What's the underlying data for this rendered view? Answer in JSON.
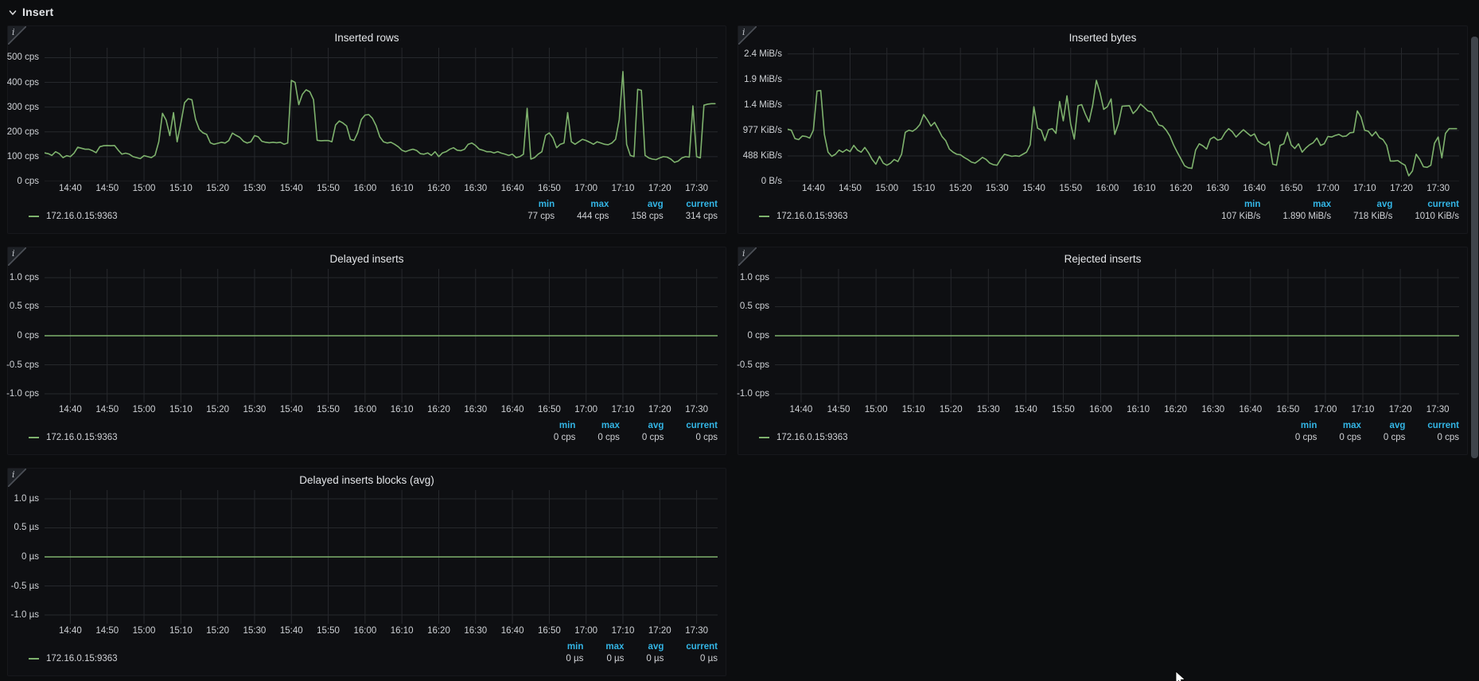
{
  "section": {
    "label": "Insert",
    "state": "expanded"
  },
  "legend": {
    "headers": [
      "min",
      "max",
      "avg",
      "current"
    ]
  },
  "time": {
    "domain": [
      873,
      1055.7
    ],
    "ticks": [
      {
        "v": 880,
        "l": "14:40"
      },
      {
        "v": 890,
        "l": "14:50"
      },
      {
        "v": 900,
        "l": "15:00"
      },
      {
        "v": 910,
        "l": "15:10"
      },
      {
        "v": 920,
        "l": "15:20"
      },
      {
        "v": 930,
        "l": "15:30"
      },
      {
        "v": 940,
        "l": "15:40"
      },
      {
        "v": 950,
        "l": "15:50"
      },
      {
        "v": 960,
        "l": "16:00"
      },
      {
        "v": 970,
        "l": "16:10"
      },
      {
        "v": 980,
        "l": "16:20"
      },
      {
        "v": 990,
        "l": "16:30"
      },
      {
        "v": 1000,
        "l": "16:40"
      },
      {
        "v": 1010,
        "l": "16:50"
      },
      {
        "v": 1020,
        "l": "17:00"
      },
      {
        "v": 1030,
        "l": "17:10"
      },
      {
        "v": 1040,
        "l": "17:20"
      },
      {
        "v": 1050,
        "l": "17:30"
      }
    ]
  },
  "panels": [
    {
      "id": "inserted-rows",
      "title": "Inserted rows",
      "type": "line",
      "col": 1,
      "row": 1,
      "yaxis_width": 46,
      "ydomain": [
        0,
        540
      ],
      "yticks": [
        {
          "v": 500,
          "l": "500 cps"
        },
        {
          "v": 400,
          "l": "400 cps"
        },
        {
          "v": 300,
          "l": "300 cps"
        },
        {
          "v": 200,
          "l": "200 cps"
        },
        {
          "v": 100,
          "l": "100 cps"
        },
        {
          "v": 0,
          "l": "0 cps"
        }
      ],
      "series": {
        "name": "172.16.0.15:9363",
        "color": "#7eb26d",
        "t0": 873,
        "dt": 1,
        "values": [
          115,
          112,
          105,
          120,
          112,
          96,
          104,
          100,
          114,
          138,
          134,
          130,
          130,
          124,
          116,
          140,
          144,
          145,
          144,
          145,
          126,
          110,
          114,
          110,
          100,
          96,
          92,
          104,
          100,
          96,
          106,
          160,
          275,
          248,
          185,
          278,
          160,
          235,
          318,
          334,
          330,
          250,
          210,
          196,
          190,
          156,
          150,
          154,
          158,
          155,
          165,
          195,
          186,
          178,
          162,
          155,
          160,
          185,
          180,
          162,
          158,
          156,
          158,
          156,
          158,
          150,
          155,
          408,
          400,
          310,
          352,
          370,
          362,
          330,
          166,
          164,
          165,
          165,
          160,
          228,
          244,
          236,
          224,
          170,
          165,
          196,
          250,
          268,
          270,
          255,
          225,
          180,
          160,
          155,
          158,
          150,
          140,
          126,
          120,
          126,
          130,
          125,
          112,
          110,
          115,
          105,
          120,
          100,
          115,
          120,
          130,
          136,
          126,
          124,
          130,
          150,
          155,
          145,
          130,
          126,
          120,
          120,
          115,
          120,
          114,
          110,
          105,
          110,
          96,
          100,
          110,
          295,
          90,
          96,
          110,
          120,
          186,
          196,
          176,
          136,
          150,
          155,
          278,
          160,
          150,
          160,
          170,
          165,
          158,
          150,
          160,
          155,
          150,
          148,
          155,
          170,
          250,
          444,
          150,
          105,
          100,
          372,
          368,
          105,
          95,
          90,
          88,
          95,
          100,
          98,
          90,
          77,
          82,
          95,
          100,
          98,
          305,
          100,
          95,
          308,
          312,
          314,
          314
        ]
      },
      "stats": [
        "77 cps",
        "444 cps",
        "158 cps",
        "314 cps"
      ]
    },
    {
      "id": "inserted-bytes",
      "title": "Inserted bytes",
      "type": "line",
      "col": 2,
      "row": 1,
      "yaxis_width": 62,
      "ydomain": [
        0,
        2560
      ],
      "yticks": [
        {
          "v": 2441,
          "l": "2.4 MiB/s"
        },
        {
          "v": 1953,
          "l": "1.9 MiB/s"
        },
        {
          "v": 1465,
          "l": "1.4 MiB/s"
        },
        {
          "v": 977,
          "l": "977 KiB/s"
        },
        {
          "v": 488,
          "l": "488 KiB/s"
        },
        {
          "v": 0,
          "l": "0 B/s"
        }
      ],
      "series": {
        "name": "172.16.0.15:9363",
        "color": "#7eb26d",
        "t0": 873,
        "dt": 1,
        "values": [
          1000,
          980,
          820,
          800,
          870,
          860,
          830,
          980,
          1730,
          1740,
          900,
          560,
          480,
          520,
          600,
          560,
          610,
          570,
          690,
          600,
          560,
          650,
          550,
          420,
          330,
          480,
          350,
          310,
          350,
          420,
          380,
          520,
          940,
          980,
          960,
          1010,
          1090,
          1280,
          1180,
          1060,
          1130,
          1000,
          860,
          780,
          620,
          560,
          520,
          510,
          460,
          420,
          370,
          350,
          400,
          460,
          420,
          350,
          320,
          310,
          430,
          520,
          500,
          480,
          490,
          480,
          520,
          560,
          700,
          1430,
          1020,
          980,
          780,
          990,
          1010,
          920,
          1530,
          1160,
          1640,
          1100,
          810,
          1450,
          1470,
          1290,
          1140,
          1460,
          1935,
          1700,
          1380,
          1430,
          1580,
          900,
          1100,
          1440,
          1445,
          1450,
          1300,
          1370,
          1480,
          1420,
          1350,
          1330,
          1200,
          1080,
          1060,
          980,
          870,
          700,
          560,
          430,
          300,
          260,
          250,
          600,
          720,
          680,
          620,
          810,
          850,
          790,
          810,
          930,
          1010,
          950,
          850,
          920,
          990,
          930,
          870,
          910,
          770,
          720,
          690,
          760,
          330,
          310,
          690,
          720,
          940,
          700,
          630,
          720,
          560,
          640,
          700,
          740,
          830,
          690,
          720,
          860,
          850,
          880,
          900,
          860,
          870,
          930,
          940,
          1350,
          1230,
          980,
          960,
          870,
          950,
          840,
          800,
          690,
          390,
          390,
          400,
          350,
          310,
          107,
          200,
          520,
          420,
          280,
          270,
          310,
          730,
          850,
          450,
          920,
          1010,
          1010,
          1010
        ]
      },
      "stats": [
        "107 KiB/s",
        "1.890 MiB/s",
        "718 KiB/s",
        "1010 KiB/s"
      ]
    },
    {
      "id": "delayed-inserts",
      "title": "Delayed inserts",
      "type": "line",
      "col": 1,
      "row": 2,
      "yaxis_width": 46,
      "ydomain": [
        -1.15,
        1.15
      ],
      "yticks": [
        {
          "v": 1,
          "l": "1.0 cps"
        },
        {
          "v": 0.5,
          "l": "0.5 cps"
        },
        {
          "v": 0,
          "l": "0 cps"
        },
        {
          "v": -0.5,
          "l": "-0.5 cps"
        },
        {
          "v": -1,
          "l": "-1.0 cps"
        }
      ],
      "series": {
        "name": "172.16.0.15:9363",
        "color": "#7eb26d",
        "t0": 873,
        "dt": 182.7,
        "values": [
          0,
          0
        ]
      },
      "stats": [
        "0 cps",
        "0 cps",
        "0 cps",
        "0 cps"
      ]
    },
    {
      "id": "rejected-inserts",
      "title": "Rejected inserts",
      "type": "line",
      "col": 2,
      "row": 2,
      "yaxis_width": 46,
      "ydomain": [
        -1.15,
        1.15
      ],
      "yticks": [
        {
          "v": 1,
          "l": "1.0 cps"
        },
        {
          "v": 0.5,
          "l": "0.5 cps"
        },
        {
          "v": 0,
          "l": "0 cps"
        },
        {
          "v": -0.5,
          "l": "-0.5 cps"
        },
        {
          "v": -1,
          "l": "-1.0 cps"
        }
      ],
      "series": {
        "name": "172.16.0.15:9363",
        "color": "#7eb26d",
        "t0": 873,
        "dt": 182.7,
        "values": [
          0,
          0
        ]
      },
      "stats": [
        "0 cps",
        "0 cps",
        "0 cps",
        "0 cps"
      ]
    },
    {
      "id": "delayed-inserts-blocks-avg",
      "title": "Delayed inserts blocks (avg)",
      "type": "line",
      "col": 1,
      "row": 3,
      "yaxis_width": 46,
      "ydomain": [
        -1.15,
        1.15
      ],
      "yticks": [
        {
          "v": 1,
          "l": "1.0 µs"
        },
        {
          "v": 0.5,
          "l": "0.5 µs"
        },
        {
          "v": 0,
          "l": "0 µs"
        },
        {
          "v": -0.5,
          "l": "-0.5 µs"
        },
        {
          "v": -1,
          "l": "-1.0 µs"
        }
      ],
      "series": {
        "name": "172.16.0.15:9363",
        "color": "#7eb26d",
        "t0": 873,
        "dt": 182.7,
        "values": [
          0,
          0
        ]
      },
      "stats": [
        "0 µs",
        "0 µs",
        "0 µs",
        "0 µs"
      ]
    }
  ],
  "colors": {
    "series_green": "#7eb26d",
    "legend_header_blue": "#33b5e5",
    "axis_text": "#cfd2d6",
    "background": "#0c0d0f"
  }
}
